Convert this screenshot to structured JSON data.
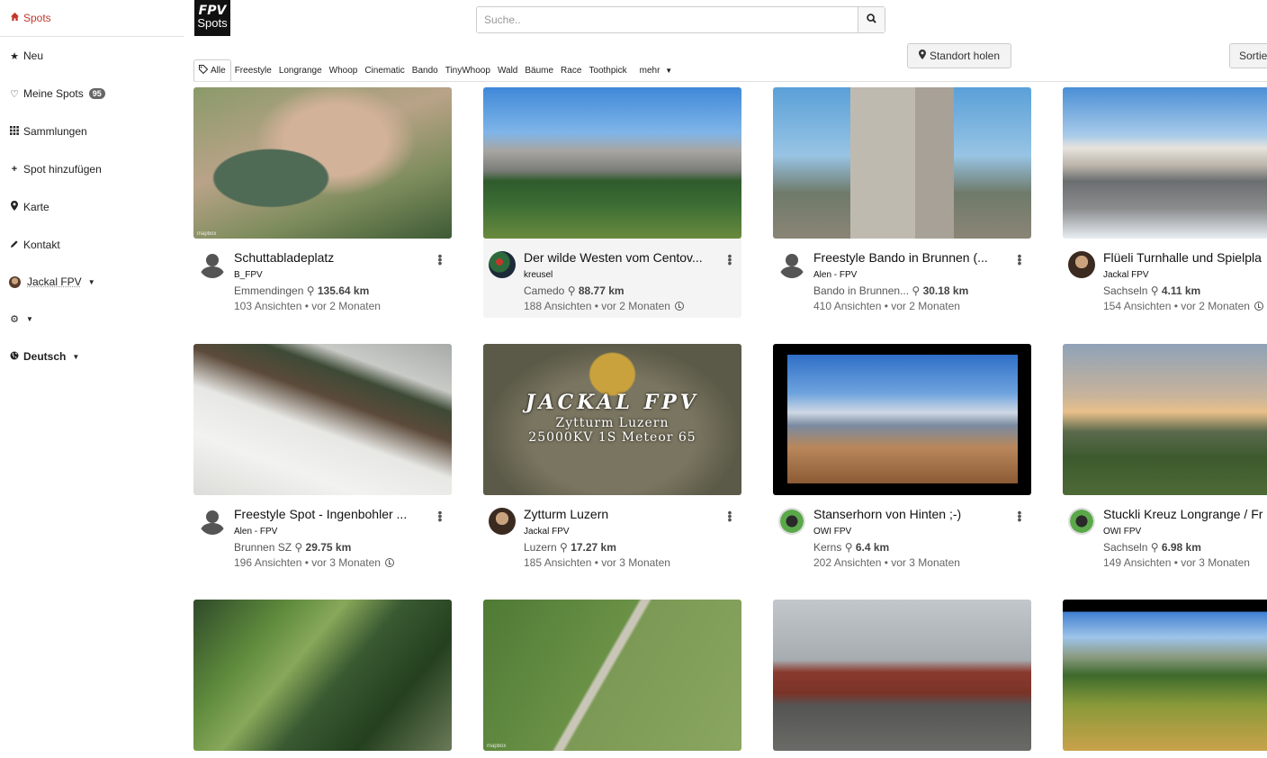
{
  "sidebar": {
    "items": [
      {
        "label": "Spots",
        "icon": "home-icon"
      },
      {
        "label": "Neu",
        "icon": "star-icon"
      },
      {
        "label": "Meine Spots",
        "icon": "heart-icon",
        "badge": "95"
      },
      {
        "label": "Sammlungen",
        "icon": "grid-icon"
      },
      {
        "label": "Spot hinzufügen",
        "icon": "plus-icon"
      },
      {
        "label": "Karte",
        "icon": "map-pin-icon"
      },
      {
        "label": "Kontakt",
        "icon": "pencil-icon"
      },
      {
        "label": "Jackal FPV",
        "icon": "user-avatar"
      },
      {
        "label": "",
        "icon": "gear-icon"
      },
      {
        "label": "Deutsch",
        "icon": "globe-icon"
      }
    ]
  },
  "header": {
    "logo_line1": "FPV",
    "logo_line2": "Spots",
    "search_placeholder": "Suche..",
    "location_button": "Standort holen",
    "sort_button": "Sortie"
  },
  "tags": {
    "items": [
      "Alle",
      "Freestyle",
      "Longrange",
      "Whoop",
      "Cinematic",
      "Bando",
      "TinyWhoop",
      "Wald",
      "Bäume",
      "Race",
      "Toothpick"
    ],
    "more": "mehr"
  },
  "cards": [
    {
      "title": "Schuttabladeplatz",
      "author": "B_FPV",
      "location": "Emmendingen",
      "distance": "135.64 km",
      "views": "103 Ansichten • vor 2 Monaten",
      "clock": false
    },
    {
      "title": "Der wilde Westen vom Centov...",
      "author": "kreusel",
      "location": "Camedo",
      "distance": "88.77 km",
      "views": "188 Ansichten • vor 2 Monaten",
      "clock": true
    },
    {
      "title": "Freestyle Bando in Brunnen (...",
      "author": "Alen - FPV",
      "location": "Bando in Brunnen...",
      "distance": "30.18 km",
      "views": "410 Ansichten • vor 2 Monaten",
      "clock": false
    },
    {
      "title": "Flüeli Turnhalle und Spielpla",
      "author": "Jackal FPV",
      "location": "Sachseln",
      "distance": "4.11 km",
      "views": "154 Ansichten • vor 2 Monaten",
      "clock": true
    },
    {
      "title": "Freestyle Spot - Ingenbohler ...",
      "author": "Alen - FPV",
      "location": "Brunnen SZ",
      "distance": "29.75 km",
      "views": "196 Ansichten • vor 3 Monaten",
      "clock": true
    },
    {
      "title": "Zytturm Luzern",
      "author": "Jackal FPV",
      "location": "Luzern",
      "distance": "17.27 km",
      "views": "185 Ansichten • vor 3 Monaten",
      "clock": false,
      "overlay": [
        "JACKAL FPV",
        "Zytturm Luzern",
        "25000KV 1S Meteor 65"
      ]
    },
    {
      "title": "Stanserhorn von Hinten ;-)",
      "author": "OWI FPV",
      "location": "Kerns",
      "distance": "6.4 km",
      "views": "202 Ansichten • vor 3 Monaten",
      "clock": false
    },
    {
      "title": "Stuckli Kreuz Longrange / Fr",
      "author": "OWI FPV",
      "location": "Sachseln",
      "distance": "6.98 km",
      "views": "149 Ansichten • vor 3 Monaten",
      "clock": false
    },
    {
      "title": "",
      "author": "",
      "location": "",
      "distance": "",
      "views": ""
    },
    {
      "title": "",
      "author": "",
      "location": "",
      "distance": "",
      "views": ""
    },
    {
      "title": "",
      "author": "",
      "location": "",
      "distance": "",
      "views": ""
    },
    {
      "title": "",
      "author": "",
      "location": "",
      "distance": "",
      "views": ""
    }
  ],
  "map_credit": "mapbox",
  "colors": {
    "accent": "#c0392b",
    "badge": "#666666"
  }
}
